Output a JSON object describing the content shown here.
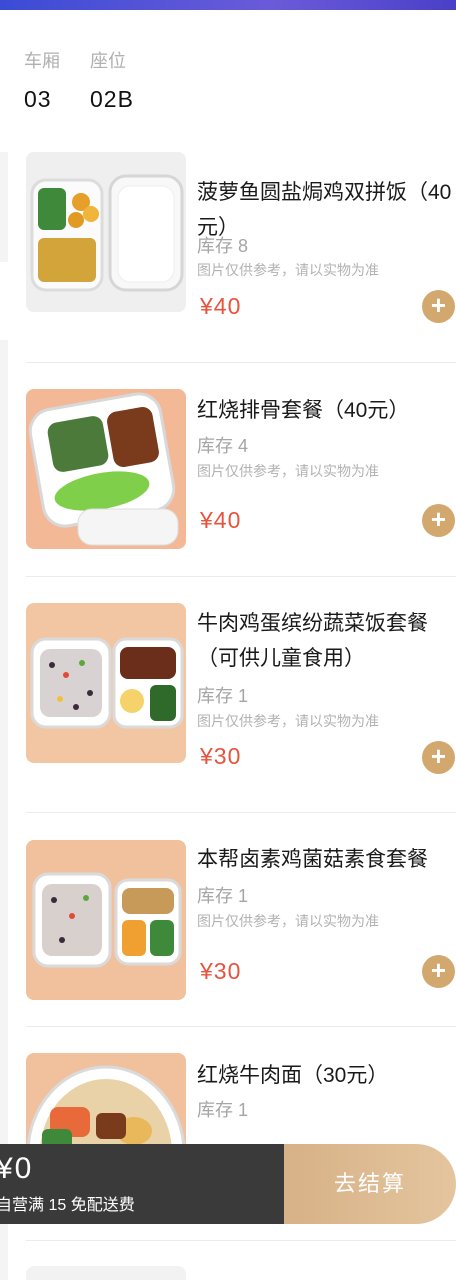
{
  "seat": {
    "car_label": "车厢",
    "car_value": "03",
    "seat_label": "座位",
    "seat_value": "02B"
  },
  "items": [
    {
      "name": "菠萝鱼圆盐焗鸡双拼饭（40元）",
      "stock": "库存 8",
      "note": "图片仅供参考，请以实物为准",
      "price": "¥40"
    },
    {
      "name": "红烧排骨套餐（40元）",
      "stock": "库存 4",
      "note": "图片仅供参考，请以实物为准",
      "price": "¥40"
    },
    {
      "name": "牛肉鸡蛋缤纷蔬菜饭套餐（可供儿童食用）",
      "stock": "库存 1",
      "note": "图片仅供参考，请以实物为准",
      "price": "¥30"
    },
    {
      "name": "本帮卤素鸡菌菇素食套餐",
      "stock": "库存 1",
      "note": "图片仅供参考，请以实物为准",
      "price": "¥30"
    },
    {
      "name": "红烧牛肉面（30元）",
      "stock": "库存 1"
    }
  ],
  "add_symbol": "+",
  "cart": {
    "total": "¥0",
    "free_delivery": "自营满 15 免配送费",
    "checkout_label": "去结算"
  },
  "colors": {
    "accent": "#d2a86e",
    "price": "#e8533d",
    "bar": "#3a3a3a"
  }
}
